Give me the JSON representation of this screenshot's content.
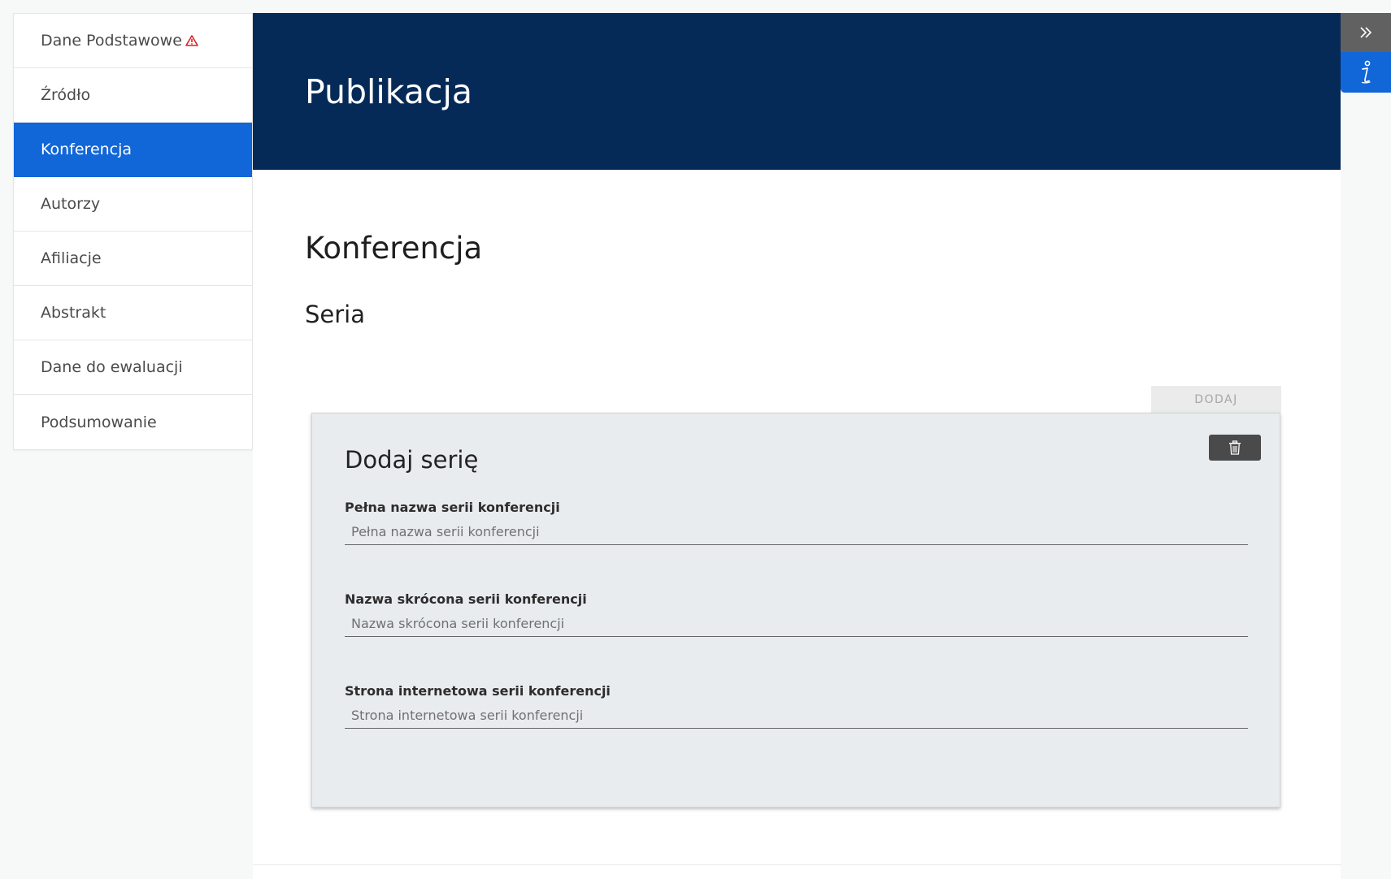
{
  "sidebar": {
    "items": [
      {
        "label": "Dane Podstawowe",
        "warning": true
      },
      {
        "label": "Źródło"
      },
      {
        "label": "Konferencja",
        "active": true
      },
      {
        "label": "Autorzy"
      },
      {
        "label": "Afiliacje"
      },
      {
        "label": "Abstrakt"
      },
      {
        "label": "Dane do ewaluacji"
      },
      {
        "label": "Podsumowanie"
      }
    ]
  },
  "header": {
    "title": "Publikacja"
  },
  "main": {
    "section_title": "Konferencja",
    "subsection_title": "Seria",
    "add_button_label": "DODAJ",
    "card": {
      "title": "Dodaj serię",
      "fields": [
        {
          "label": "Pełna nazwa serii konferencji",
          "placeholder": "Pełna nazwa serii konferencji",
          "value": ""
        },
        {
          "label": "Nazwa skrócona serii konferencji",
          "placeholder": "Nazwa skrócona serii konferencji",
          "value": ""
        },
        {
          "label": "Strona internetowa serii konferencji",
          "placeholder": "Strona internetowa serii konferencji",
          "value": ""
        }
      ]
    }
  },
  "icons": {
    "warning": "warning-triangle-icon",
    "delete": "trash-icon",
    "expand": "double-chevron-right-icon",
    "info": "info-icon"
  },
  "colors": {
    "header_bg": "#062a58",
    "active_item_bg": "#1166d8",
    "warning": "#e02020",
    "card_bg": "#e9ecef",
    "rail_expand_bg": "#616161",
    "rail_info_bg": "#1166d8"
  }
}
